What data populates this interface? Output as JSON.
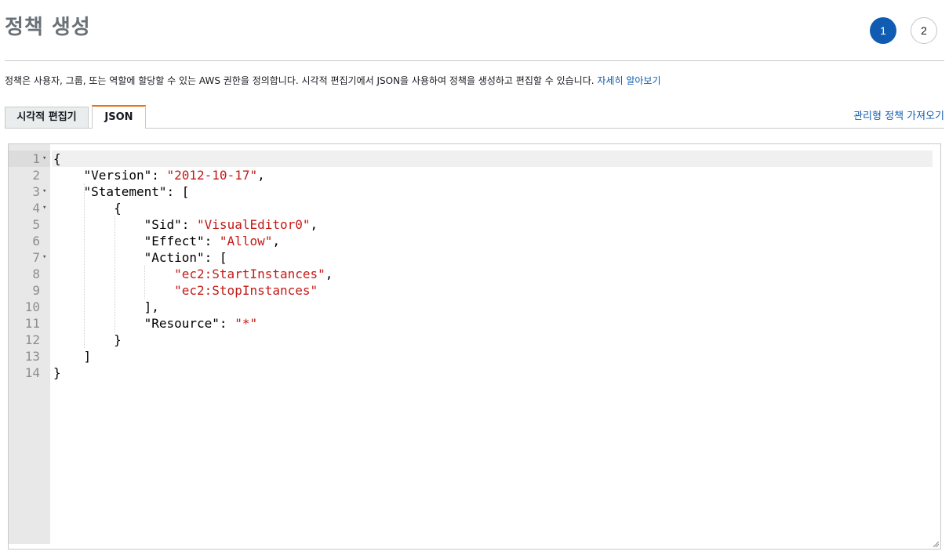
{
  "header": {
    "title": "정책 생성",
    "steps": [
      "1",
      "2"
    ]
  },
  "description": {
    "text": "정책은 사용자, 그룹, 또는 역할에 할당할 수 있는 AWS 권한을 정의합니다. 시각적 편집기에서 JSON을 사용하여 정책을 생성하고 편집할 수 있습니다.",
    "link": "자세히 알아보기"
  },
  "tabs": [
    {
      "label": "시각적 편집기",
      "active": false
    },
    {
      "label": "JSON",
      "active": true
    }
  ],
  "import_link": "관리형 정책 가져오기",
  "editor": {
    "line_numbers": [
      "1",
      "2",
      "3",
      "4",
      "5",
      "6",
      "7",
      "8",
      "9",
      "10",
      "11",
      "12",
      "13",
      "14"
    ],
    "lines": [
      {
        "indent": "",
        "parts": [
          {
            "t": "{",
            "s": false
          }
        ]
      },
      {
        "indent": "    ",
        "parts": [
          {
            "t": "\"Version\": ",
            "s": false
          },
          {
            "t": "\"2012-10-17\"",
            "s": true
          },
          {
            "t": ",",
            "s": false
          }
        ]
      },
      {
        "indent": "    ",
        "parts": [
          {
            "t": "\"Statement\": [",
            "s": false
          }
        ]
      },
      {
        "indent": "        ",
        "parts": [
          {
            "t": "{",
            "s": false
          }
        ]
      },
      {
        "indent": "            ",
        "parts": [
          {
            "t": "\"Sid\": ",
            "s": false
          },
          {
            "t": "\"VisualEditor0\"",
            "s": true
          },
          {
            "t": ",",
            "s": false
          }
        ]
      },
      {
        "indent": "            ",
        "parts": [
          {
            "t": "\"Effect\": ",
            "s": false
          },
          {
            "t": "\"Allow\"",
            "s": true
          },
          {
            "t": ",",
            "s": false
          }
        ]
      },
      {
        "indent": "            ",
        "parts": [
          {
            "t": "\"Action\": [",
            "s": false
          }
        ]
      },
      {
        "indent": "                ",
        "parts": [
          {
            "t": "\"ec2:StartInstances\"",
            "s": true
          },
          {
            "t": ",",
            "s": false
          }
        ]
      },
      {
        "indent": "                ",
        "parts": [
          {
            "t": "\"ec2:StopInstances\"",
            "s": true
          }
        ]
      },
      {
        "indent": "            ",
        "parts": [
          {
            "t": "],",
            "s": false
          }
        ]
      },
      {
        "indent": "            ",
        "parts": [
          {
            "t": "\"Resource\": ",
            "s": false
          },
          {
            "t": "\"*\"",
            "s": true
          }
        ]
      },
      {
        "indent": "        ",
        "parts": [
          {
            "t": "}",
            "s": false
          }
        ]
      },
      {
        "indent": "    ",
        "parts": [
          {
            "t": "]",
            "s": false
          }
        ]
      },
      {
        "indent": "",
        "parts": [
          {
            "t": "}",
            "s": false
          }
        ]
      }
    ],
    "foldable_lines": [
      1,
      3,
      4,
      7
    ]
  },
  "colors": {
    "accent": "#0f5cb2",
    "tab_active_border": "#ec7211",
    "json_string": "#c41a16"
  }
}
